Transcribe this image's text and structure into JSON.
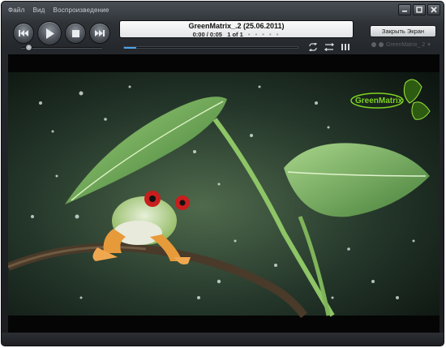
{
  "menu": [
    "Файл",
    "Вид",
    "Воспроизведение"
  ],
  "window_controls": [
    {
      "name": "minimize",
      "icon": "minimize-icon"
    },
    {
      "name": "maximize",
      "icon": "maximize-icon"
    },
    {
      "name": "close",
      "icon": "close-icon"
    }
  ],
  "transport": [
    {
      "name": "previous",
      "icon": "previous-icon"
    },
    {
      "name": "play",
      "icon": "play-icon"
    },
    {
      "name": "stop",
      "icon": "stop-icon"
    },
    {
      "name": "next",
      "icon": "next-icon"
    }
  ],
  "volume": {
    "level": 0.05
  },
  "now_playing": {
    "title": "GreenMatrix_.2 (25.06.2011)",
    "time": "0:00 / 0:05",
    "position": "1 of 1",
    "dots": "• • • • •"
  },
  "seek": {
    "progress": 0.07
  },
  "right_icons": [
    "repeat-icon",
    "shuffle-icon",
    "equalizer-icon"
  ],
  "fullscreen_button": {
    "label": "Закрыть Экран"
  },
  "playlist": {
    "label": "GreenMatrix_.2"
  },
  "watermark": {
    "text": "GreenMatrix"
  },
  "colors": {
    "accent": "#4aa3e8",
    "watermark": "#7ed321"
  }
}
